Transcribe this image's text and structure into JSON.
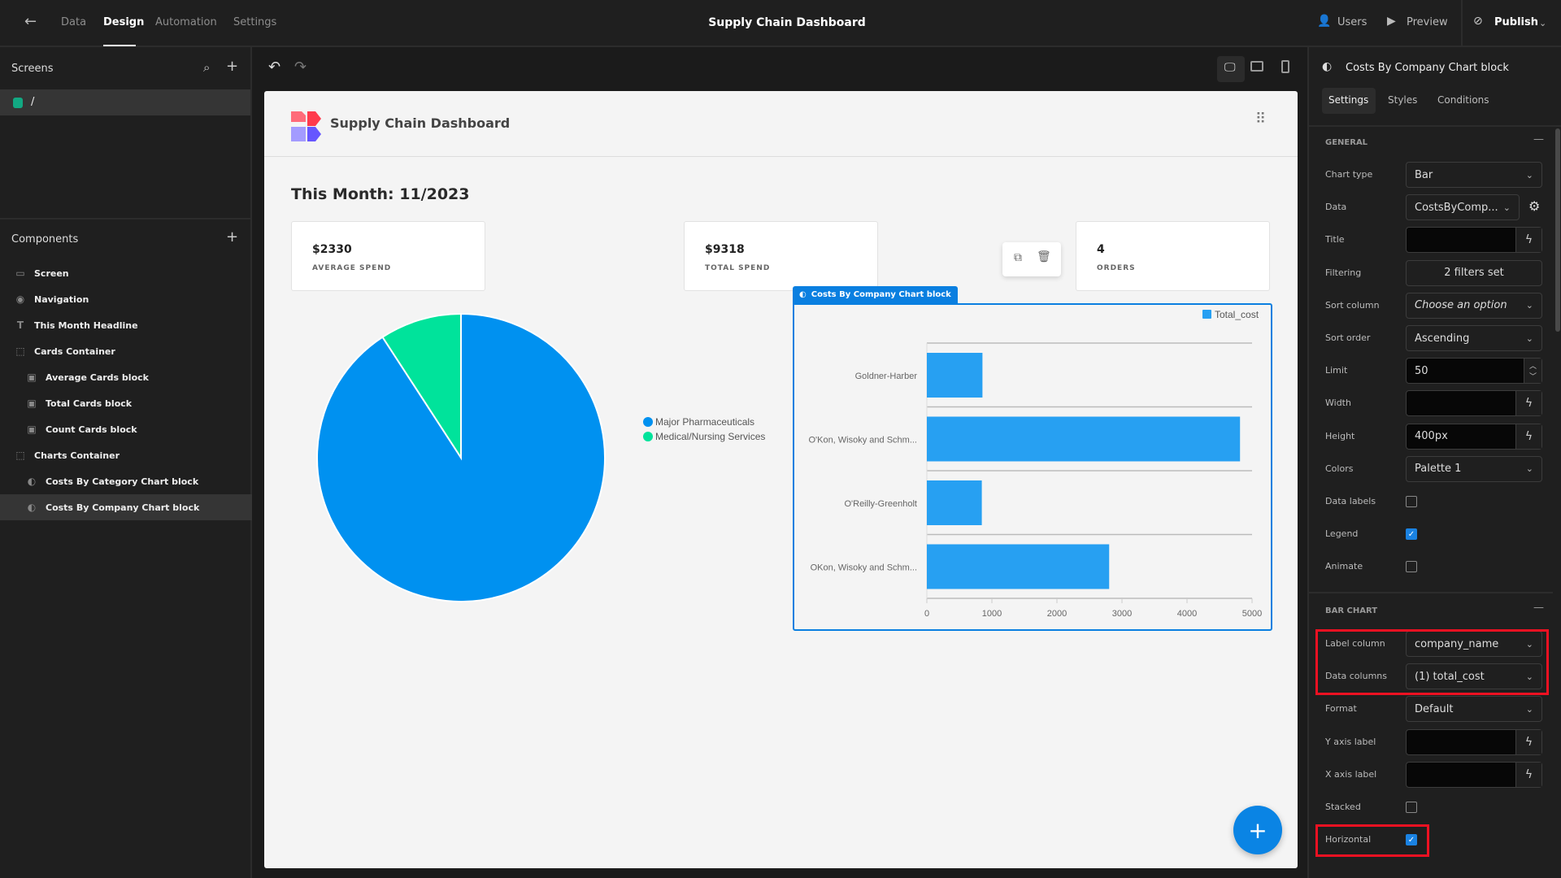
{
  "topbar": {
    "tabs": [
      "Data",
      "Design",
      "Automation",
      "Settings"
    ],
    "active_tab": "Design",
    "title": "Supply Chain Dashboard",
    "users": "Users",
    "preview": "Preview",
    "publish": "Publish"
  },
  "left": {
    "screens_title": "Screens",
    "screen_route": "/",
    "components_title": "Components",
    "components": [
      {
        "label": "Screen",
        "icon": "screen-icon",
        "indent": 0
      },
      {
        "label": "Navigation",
        "icon": "eye-icon",
        "indent": 0
      },
      {
        "label": "This Month Headline",
        "icon": "text-icon",
        "indent": 0
      },
      {
        "label": "Cards Container",
        "icon": "container-icon",
        "indent": 0
      },
      {
        "label": "Average Cards block",
        "icon": "card-block-icon",
        "indent": 1
      },
      {
        "label": "Total Cards block",
        "icon": "card-block-icon",
        "indent": 1
      },
      {
        "label": "Count Cards block",
        "icon": "card-block-icon",
        "indent": 1
      },
      {
        "label": "Charts Container",
        "icon": "container-icon",
        "indent": 0
      },
      {
        "label": "Costs By Category Chart block",
        "icon": "chart-icon",
        "indent": 1
      },
      {
        "label": "Costs By Company Chart block",
        "icon": "chart-icon",
        "indent": 1,
        "selected": true
      }
    ]
  },
  "canvas": {
    "app_title": "Supply Chain Dashboard",
    "headline": "This Month: 11/2023",
    "cards": [
      {
        "value": "$2330",
        "label": "AVERAGE SPEND"
      },
      {
        "value": "$9318",
        "label": "TOTAL SPEND"
      },
      {
        "value": "4",
        "label": "ORDERS"
      }
    ],
    "selected_block_label": "Costs By Company Chart block"
  },
  "chart_data": [
    {
      "type": "pie",
      "categories": [
        "Major Pharmaceuticals",
        "Medical/Nursing Services"
      ],
      "values": [
        8463,
        855
      ],
      "colors": [
        "#0091f0",
        "#00e39b"
      ],
      "legend": "right"
    },
    {
      "type": "bar",
      "orientation": "horizontal",
      "categories": [
        "Goldner-Harber",
        "O'Kon, Wisoky and Schm...",
        "O'Reilly-Greenholt",
        "OKon, Wisoky and Schm..."
      ],
      "series": [
        {
          "name": "Total_cost",
          "values": [
            855,
            4815,
            845,
            2803
          ]
        }
      ],
      "color": "#27a0f2",
      "xlim": [
        0,
        5000
      ],
      "xticks": [
        "0",
        "1000",
        "2000",
        "3000",
        "4000",
        "5000"
      ],
      "legend": "top-right",
      "grid": true
    }
  ],
  "panel": {
    "title": "Costs By Company Chart block",
    "tabs": [
      "Settings",
      "Styles",
      "Conditions"
    ],
    "active_tab": "Settings",
    "general_title": "GENERAL",
    "bar_title": "BAR CHART",
    "general": [
      {
        "label": "Chart type",
        "type": "select",
        "value": "Bar"
      },
      {
        "label": "Data",
        "type": "select-gear",
        "value": "CostsByComp..."
      },
      {
        "label": "Title",
        "type": "binding",
        "value": ""
      },
      {
        "label": "Filtering",
        "type": "button",
        "value": "2 filters set"
      },
      {
        "label": "Sort column",
        "type": "select",
        "value": "Choose an option",
        "placeholder": true
      },
      {
        "label": "Sort order",
        "type": "select",
        "value": "Ascending"
      },
      {
        "label": "Limit",
        "type": "number",
        "value": "50"
      },
      {
        "label": "Width",
        "type": "binding",
        "value": ""
      },
      {
        "label": "Height",
        "type": "binding",
        "value": "400px"
      },
      {
        "label": "Colors",
        "type": "select",
        "value": "Palette 1"
      },
      {
        "label": "Data labels",
        "type": "checkbox",
        "checked": false
      },
      {
        "label": "Legend",
        "type": "checkbox",
        "checked": true
      },
      {
        "label": "Animate",
        "type": "checkbox",
        "checked": false
      }
    ],
    "bar": [
      {
        "label": "Label column",
        "type": "select",
        "value": "company_name"
      },
      {
        "label": "Data columns",
        "type": "select",
        "value": "(1) total_cost"
      },
      {
        "label": "Format",
        "type": "select",
        "value": "Default"
      },
      {
        "label": "Y axis label",
        "type": "binding",
        "value": ""
      },
      {
        "label": "X axis label",
        "type": "binding",
        "value": ""
      },
      {
        "label": "Stacked",
        "type": "checkbox",
        "checked": false
      },
      {
        "label": "Horizontal",
        "type": "checkbox",
        "checked": true
      }
    ],
    "highlight_color": "#ee1122"
  }
}
